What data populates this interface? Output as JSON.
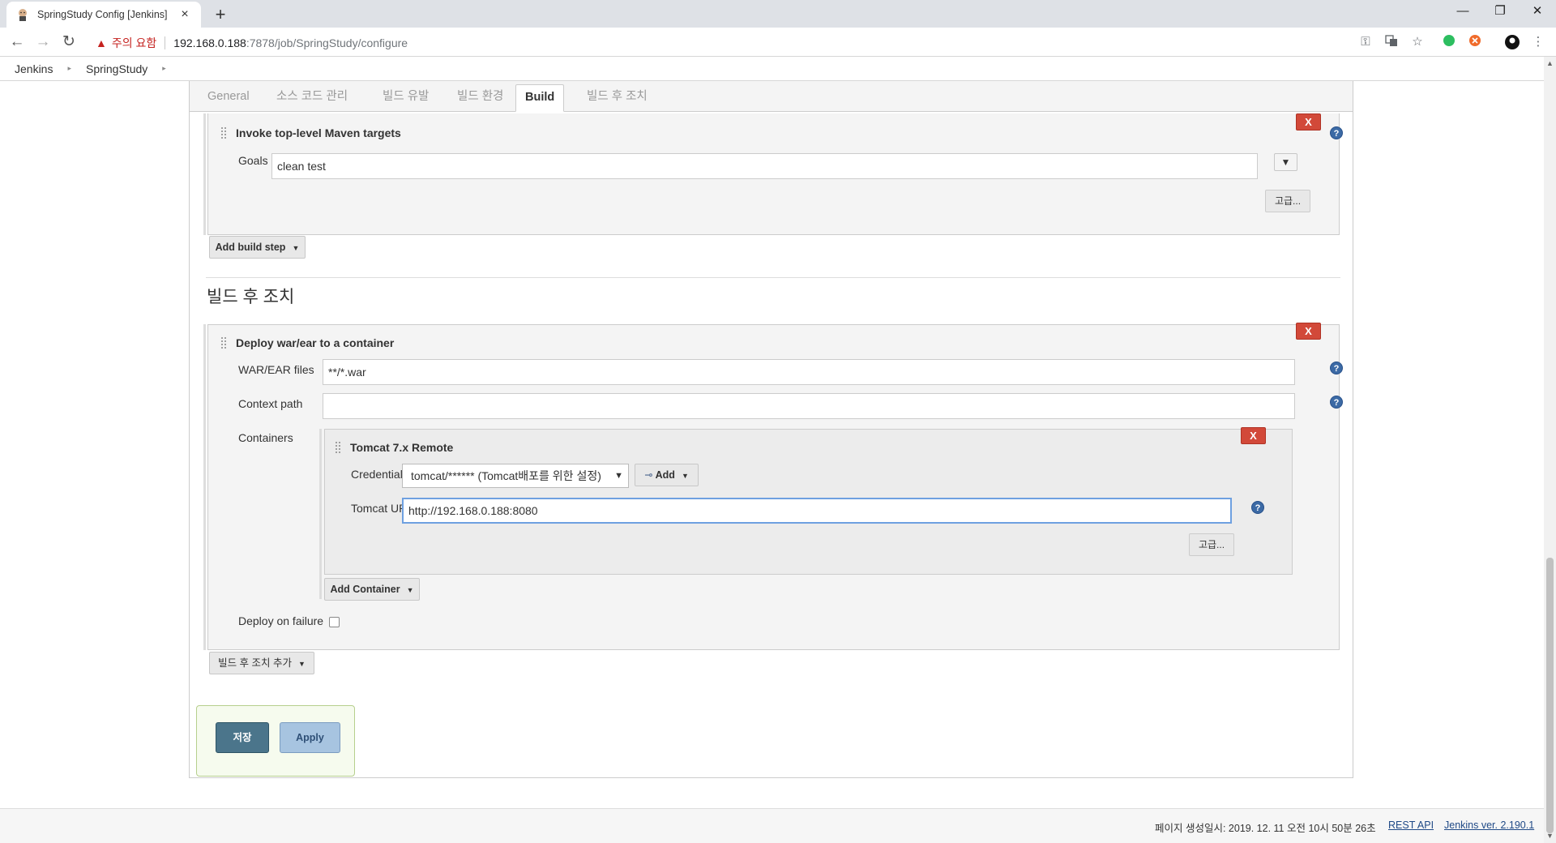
{
  "browser": {
    "tab_title": "SpringStudy Config [Jenkins]",
    "tab_close": "×",
    "new_tab": "+",
    "window_controls": {
      "minimize": "—",
      "restore": "❐",
      "close": "✕"
    },
    "nav": {
      "back": "←",
      "forward": "→",
      "reload": "↻"
    },
    "security_warning": "주의 요함",
    "url_host": "192.168.0.188",
    "url_rest": ":7878/job/SpringStudy/configure",
    "toolbar_icons": [
      "key-icon",
      "translate-icon",
      "bookmark-star-icon",
      "evernote-icon",
      "extension-icon",
      "profile-icon",
      "menu-icon"
    ]
  },
  "breadcrumb": {
    "items": [
      "Jenkins",
      "SpringStudy"
    ],
    "arrow": "▸"
  },
  "config_tabs": {
    "items": [
      "General",
      "소스 코드 관리",
      "빌드 유발",
      "빌드 환경",
      "Build",
      "빌드 후 조치"
    ],
    "active": "Build"
  },
  "build_step": {
    "title": "Invoke top-level Maven targets",
    "delete_label": "X",
    "goals_label": "Goals",
    "goals_value": "clean test",
    "expand_label": "▼",
    "advanced_label": "고급...",
    "help": "?"
  },
  "add_build_step_label": "Add build step",
  "post_build": {
    "heading": "빌드 후 조치",
    "deploy": {
      "title": "Deploy war/ear to a container",
      "delete_label": "X",
      "war_label": "WAR/EAR files",
      "war_value": "**/*.war",
      "context_label": "Context path",
      "context_value": "",
      "containers_label": "Containers",
      "container": {
        "title": "Tomcat 7.x Remote",
        "delete_label": "X",
        "credentials_label": "Credentials",
        "credentials_value": "tomcat/****** (Tomcat배포를 위한 설정)",
        "add_label": "Add",
        "url_label": "Tomcat URL",
        "url_value": "http://192.168.0.188:8080",
        "advanced_label": "고급..."
      },
      "add_container_label": "Add Container",
      "deploy_failure_label": "Deploy on failure",
      "deploy_failure_checked": false
    },
    "add_post_build_label": "빌드 후 조치 추가"
  },
  "actions": {
    "save": "저장",
    "apply": "Apply"
  },
  "footer": {
    "generated": "페이지 생성일시: 2019. 12. 11 오전 10시 50분 26초",
    "rest_api": "REST API",
    "version": "Jenkins ver. 2.190.1"
  },
  "colors": {
    "delete_red": "#d24939",
    "save_blue": "#4b758b",
    "apply_blue": "#a7c4e0",
    "help_blue": "#3c6aa5",
    "warning_red": "#c5221f"
  }
}
